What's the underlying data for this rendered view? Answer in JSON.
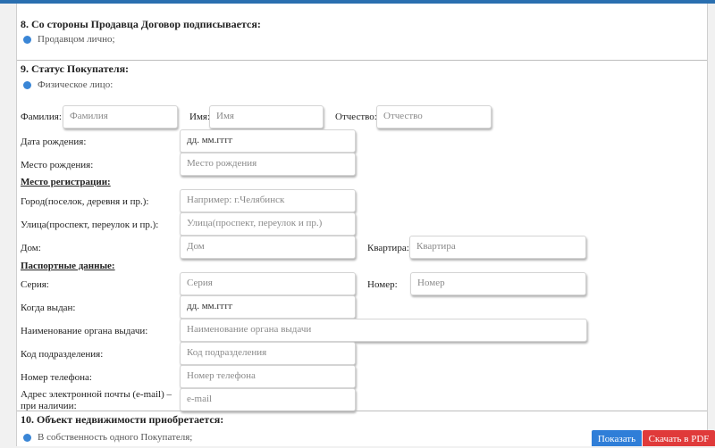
{
  "sections": {
    "s8": {
      "title": "8. Со стороны Продавца Договор подписывается:",
      "option": "Продавцом лично;"
    },
    "s9": {
      "title": "9. Статус Покупателя:",
      "option": "Физическое лицо:"
    },
    "s10": {
      "title": "10. Объект недвижимости приобретается:",
      "option": "В собственность одного Покупателя;"
    }
  },
  "name_row": {
    "surname_label": "Фамилия:",
    "surname_placeholder": "Фамилия",
    "name_label": "Имя:",
    "name_placeholder": "Имя",
    "patronymic_label": "Отчество:",
    "patronymic_placeholder": "Отчество"
  },
  "birth": {
    "date_label": "Дата рождения:",
    "date_value": "дд. мм.гггг",
    "place_label": "Место рождения:",
    "place_placeholder": "Место рождения"
  },
  "registration": {
    "title": "Место регистрации:",
    "city_label": "Город(поселок, деревня и пр.):",
    "city_placeholder": "Например: г.Челябинск",
    "street_label": "Улица(проспект, переулок и пр.):",
    "street_placeholder": "Улица(проспект, переулок и пр.)",
    "house_label": "Дом:",
    "house_placeholder": "Дом",
    "apartment_label": "Квартира:",
    "apartment_placeholder": "Квартира"
  },
  "passport": {
    "title": "Паспортные данные:",
    "series_label": "Серия:",
    "series_placeholder": "Серия",
    "number_label": "Номер:",
    "number_placeholder": "Номер",
    "issued_label": "Когда выдан:",
    "issued_value": "дд. мм.гггг",
    "authority_label": "Наименование органа выдачи:",
    "authority_placeholder": "Наименование органа выдачи",
    "code_label": "Код подразделения:",
    "code_placeholder": "Код подразделения"
  },
  "contacts": {
    "phone_label": "Номер телефона:",
    "phone_placeholder": "Номер телефона",
    "email_label_1": "Адрес электронной почты (e-mail) –",
    "email_label_2": "при наличии:",
    "email_placeholder": "e-mail"
  },
  "buttons": {
    "show": "Показать",
    "pdf": "Скачать в PDF"
  },
  "colors": {
    "accent": "#2f7ed8",
    "danger": "#e03a3a",
    "radio": "#3a86d6",
    "topbar": "#2a6fb0"
  }
}
